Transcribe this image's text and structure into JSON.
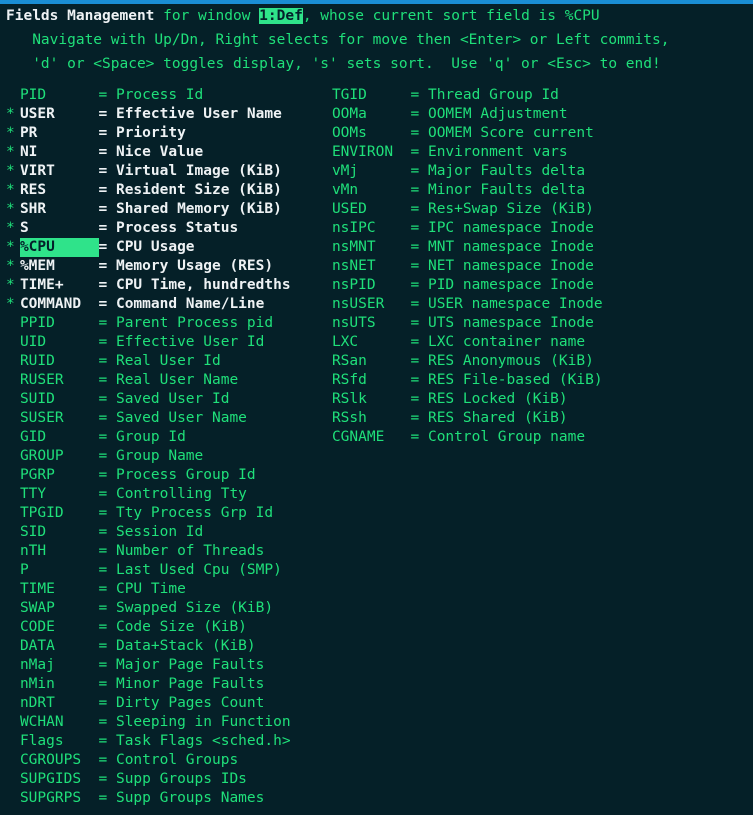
{
  "window": {
    "title_bold": "Fields Management",
    "title_rest_1": " for window ",
    "window_tag": "1:Def",
    "title_rest_2": ", whose current sort field is %CPU",
    "help_line_1": "   Navigate with Up/Dn, Right selects for move then <Enter> or Left commits,",
    "help_line_2": "   'd' or <Space> toggles display, 's' sets sort.  Use 'q' or <Esc> to end!"
  },
  "colors": {
    "background": "#052028",
    "green": "#1fe07a",
    "bright_white": "#eef2f4",
    "highlight_bg": "#2fe38a",
    "highlight_fg": "#04202a",
    "topbar_blue": "#1a8ed4"
  },
  "legend": {
    "marker": "*",
    "equals": "=",
    "cursor_field": "%CPU",
    "sort_field": "%CPU",
    "window_name": "1:Def"
  },
  "left_column": [
    {
      "marked": false,
      "cursor": false,
      "name": "PID",
      "desc": "Process Id"
    },
    {
      "marked": true,
      "cursor": false,
      "name": "USER",
      "desc": "Effective User Name"
    },
    {
      "marked": true,
      "cursor": false,
      "name": "PR",
      "desc": "Priority"
    },
    {
      "marked": true,
      "cursor": false,
      "name": "NI",
      "desc": "Nice Value"
    },
    {
      "marked": true,
      "cursor": false,
      "name": "VIRT",
      "desc": "Virtual Image (KiB)"
    },
    {
      "marked": true,
      "cursor": false,
      "name": "RES",
      "desc": "Resident Size (KiB)"
    },
    {
      "marked": true,
      "cursor": false,
      "name": "SHR",
      "desc": "Shared Memory (KiB)"
    },
    {
      "marked": true,
      "cursor": false,
      "name": "S",
      "desc": "Process Status"
    },
    {
      "marked": true,
      "cursor": true,
      "name": "%CPU",
      "desc": "CPU Usage"
    },
    {
      "marked": true,
      "cursor": false,
      "name": "%MEM",
      "desc": "Memory Usage (RES)"
    },
    {
      "marked": true,
      "cursor": false,
      "name": "TIME+",
      "desc": "CPU Time, hundredths"
    },
    {
      "marked": true,
      "cursor": false,
      "name": "COMMAND",
      "desc": "Command Name/Line"
    },
    {
      "marked": false,
      "cursor": false,
      "name": "PPID",
      "desc": "Parent Process pid"
    },
    {
      "marked": false,
      "cursor": false,
      "name": "UID",
      "desc": "Effective User Id"
    },
    {
      "marked": false,
      "cursor": false,
      "name": "RUID",
      "desc": "Real User Id"
    },
    {
      "marked": false,
      "cursor": false,
      "name": "RUSER",
      "desc": "Real User Name"
    },
    {
      "marked": false,
      "cursor": false,
      "name": "SUID",
      "desc": "Saved User Id"
    },
    {
      "marked": false,
      "cursor": false,
      "name": "SUSER",
      "desc": "Saved User Name"
    },
    {
      "marked": false,
      "cursor": false,
      "name": "GID",
      "desc": "Group Id"
    },
    {
      "marked": false,
      "cursor": false,
      "name": "GROUP",
      "desc": "Group Name"
    },
    {
      "marked": false,
      "cursor": false,
      "name": "PGRP",
      "desc": "Process Group Id"
    },
    {
      "marked": false,
      "cursor": false,
      "name": "TTY",
      "desc": "Controlling Tty"
    },
    {
      "marked": false,
      "cursor": false,
      "name": "TPGID",
      "desc": "Tty Process Grp Id"
    },
    {
      "marked": false,
      "cursor": false,
      "name": "SID",
      "desc": "Session Id"
    },
    {
      "marked": false,
      "cursor": false,
      "name": "nTH",
      "desc": "Number of Threads"
    },
    {
      "marked": false,
      "cursor": false,
      "name": "P",
      "desc": "Last Used Cpu (SMP)"
    },
    {
      "marked": false,
      "cursor": false,
      "name": "TIME",
      "desc": "CPU Time"
    },
    {
      "marked": false,
      "cursor": false,
      "name": "SWAP",
      "desc": "Swapped Size (KiB)"
    },
    {
      "marked": false,
      "cursor": false,
      "name": "CODE",
      "desc": "Code Size (KiB)"
    },
    {
      "marked": false,
      "cursor": false,
      "name": "DATA",
      "desc": "Data+Stack (KiB)"
    },
    {
      "marked": false,
      "cursor": false,
      "name": "nMaj",
      "desc": "Major Page Faults"
    },
    {
      "marked": false,
      "cursor": false,
      "name": "nMin",
      "desc": "Minor Page Faults"
    },
    {
      "marked": false,
      "cursor": false,
      "name": "nDRT",
      "desc": "Dirty Pages Count"
    },
    {
      "marked": false,
      "cursor": false,
      "name": "WCHAN",
      "desc": "Sleeping in Function"
    },
    {
      "marked": false,
      "cursor": false,
      "name": "Flags",
      "desc": "Task Flags <sched.h>"
    },
    {
      "marked": false,
      "cursor": false,
      "name": "CGROUPS",
      "desc": "Control Groups"
    },
    {
      "marked": false,
      "cursor": false,
      "name": "SUPGIDS",
      "desc": "Supp Groups IDs"
    },
    {
      "marked": false,
      "cursor": false,
      "name": "SUPGRPS",
      "desc": "Supp Groups Names"
    }
  ],
  "right_column": [
    {
      "marked": false,
      "cursor": false,
      "name": "TGID",
      "desc": "Thread Group Id"
    },
    {
      "marked": false,
      "cursor": false,
      "name": "OOMa",
      "desc": "OOMEM Adjustment"
    },
    {
      "marked": false,
      "cursor": false,
      "name": "OOMs",
      "desc": "OOMEM Score current"
    },
    {
      "marked": false,
      "cursor": false,
      "name": "ENVIRON",
      "desc": "Environment vars"
    },
    {
      "marked": false,
      "cursor": false,
      "name": "vMj",
      "desc": "Major Faults delta"
    },
    {
      "marked": false,
      "cursor": false,
      "name": "vMn",
      "desc": "Minor Faults delta"
    },
    {
      "marked": false,
      "cursor": false,
      "name": "USED",
      "desc": "Res+Swap Size (KiB)"
    },
    {
      "marked": false,
      "cursor": false,
      "name": "nsIPC",
      "desc": "IPC namespace Inode"
    },
    {
      "marked": false,
      "cursor": false,
      "name": "nsMNT",
      "desc": "MNT namespace Inode"
    },
    {
      "marked": false,
      "cursor": false,
      "name": "nsNET",
      "desc": "NET namespace Inode"
    },
    {
      "marked": false,
      "cursor": false,
      "name": "nsPID",
      "desc": "PID namespace Inode"
    },
    {
      "marked": false,
      "cursor": false,
      "name": "nsUSER",
      "desc": "USER namespace Inode"
    },
    {
      "marked": false,
      "cursor": false,
      "name": "nsUTS",
      "desc": "UTS namespace Inode"
    },
    {
      "marked": false,
      "cursor": false,
      "name": "LXC",
      "desc": "LXC container name"
    },
    {
      "marked": false,
      "cursor": false,
      "name": "RSan",
      "desc": "RES Anonymous (KiB)"
    },
    {
      "marked": false,
      "cursor": false,
      "name": "RSfd",
      "desc": "RES File-based (KiB)"
    },
    {
      "marked": false,
      "cursor": false,
      "name": "RSlk",
      "desc": "RES Locked (KiB)"
    },
    {
      "marked": false,
      "cursor": false,
      "name": "RSsh",
      "desc": "RES Shared (KiB)"
    },
    {
      "marked": false,
      "cursor": false,
      "name": "CGNAME",
      "desc": "Control Group name"
    }
  ]
}
